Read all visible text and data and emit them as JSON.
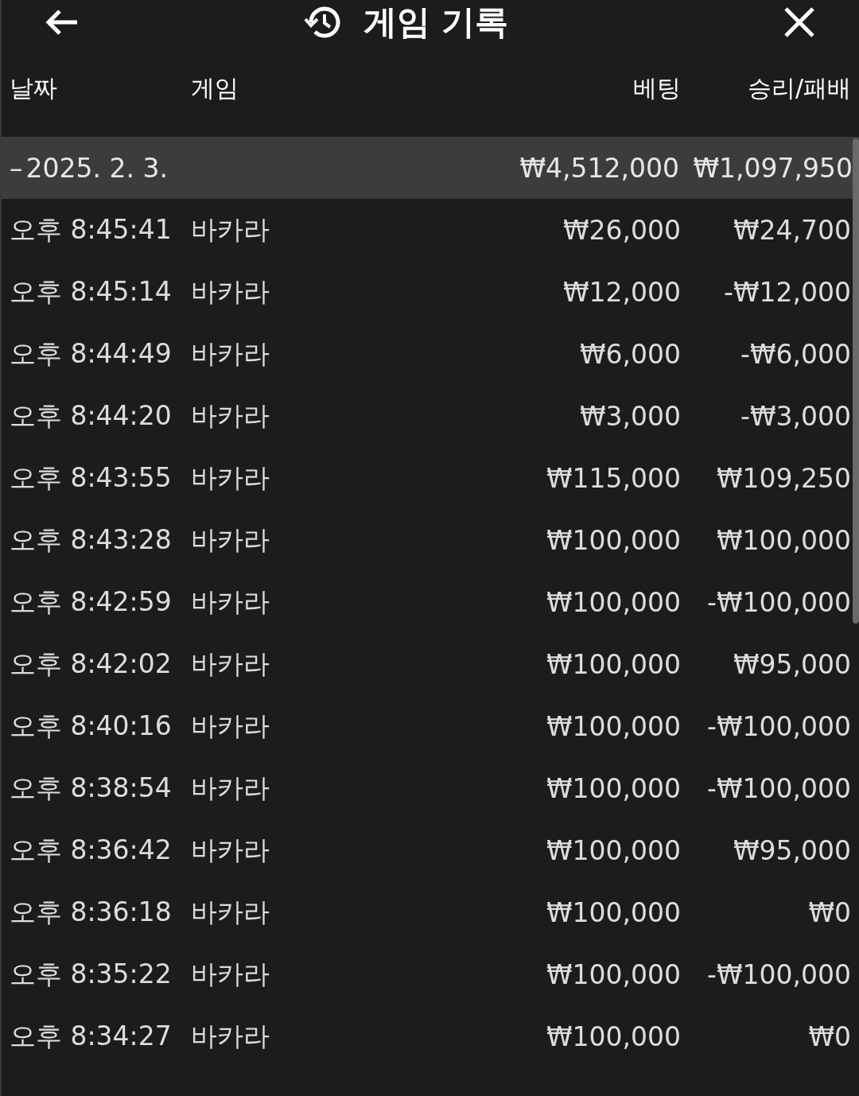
{
  "header": {
    "title": "게임 기록"
  },
  "columns": [
    "날짜",
    "게임",
    "베팅",
    "승리/패배"
  ],
  "group": {
    "expanded": true,
    "toggle": "–",
    "date": "2025. 2. 3.",
    "bet": "₩4,512,000",
    "result": "₩1,097,950"
  },
  "rows": [
    {
      "time": "오후 8:45:41",
      "game": "바카라",
      "bet": "₩26,000",
      "result": "₩24,700"
    },
    {
      "time": "오후 8:45:14",
      "game": "바카라",
      "bet": "₩12,000",
      "result": "-₩12,000"
    },
    {
      "time": "오후 8:44:49",
      "game": "바카라",
      "bet": "₩6,000",
      "result": "-₩6,000"
    },
    {
      "time": "오후 8:44:20",
      "game": "바카라",
      "bet": "₩3,000",
      "result": "-₩3,000"
    },
    {
      "time": "오후 8:43:55",
      "game": "바카라",
      "bet": "₩115,000",
      "result": "₩109,250"
    },
    {
      "time": "오후 8:43:28",
      "game": "바카라",
      "bet": "₩100,000",
      "result": "₩100,000"
    },
    {
      "time": "오후 8:42:59",
      "game": "바카라",
      "bet": "₩100,000",
      "result": "-₩100,000"
    },
    {
      "time": "오후 8:42:02",
      "game": "바카라",
      "bet": "₩100,000",
      "result": "₩95,000"
    },
    {
      "time": "오후 8:40:16",
      "game": "바카라",
      "bet": "₩100,000",
      "result": "-₩100,000"
    },
    {
      "time": "오후 8:38:54",
      "game": "바카라",
      "bet": "₩100,000",
      "result": "-₩100,000"
    },
    {
      "time": "오후 8:36:42",
      "game": "바카라",
      "bet": "₩100,000",
      "result": "₩95,000"
    },
    {
      "time": "오후 8:36:18",
      "game": "바카라",
      "bet": "₩100,000",
      "result": "₩0"
    },
    {
      "time": "오후 8:35:22",
      "game": "바카라",
      "bet": "₩100,000",
      "result": "-₩100,000"
    },
    {
      "time": "오후 8:34:27",
      "game": "바카라",
      "bet": "₩100,000",
      "result": "₩0"
    }
  ]
}
